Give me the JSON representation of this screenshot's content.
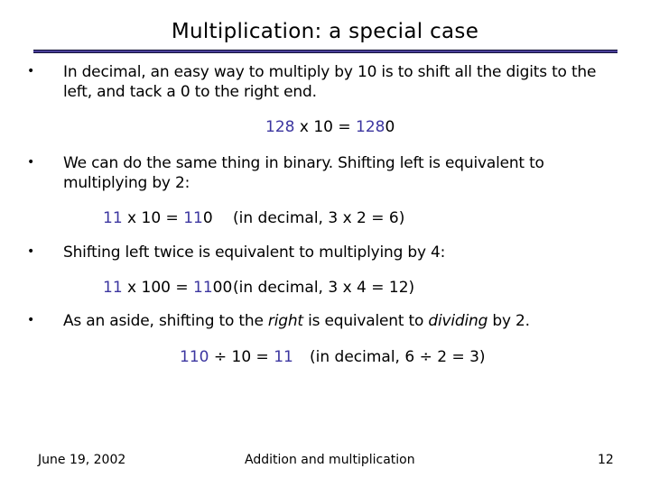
{
  "slide": {
    "title": "Multiplication: a special case",
    "accent_color": "#3c36a0",
    "rule_color": "#4a3f9a",
    "bullet_glyph": "•",
    "bullets": [
      {
        "line1": "In decimal, an easy way to multiply by 10 is to shift all the digits to the",
        "line2": "left, and tack a 0 to the right end."
      },
      {
        "line1": "We can do the same thing in binary. Shifting left is equivalent to",
        "line2": "multiplying by 2:"
      },
      {
        "line1": "Shifting left twice is equivalent to multiplying by 4:"
      },
      {
        "pre": "As an aside, shifting to the ",
        "em1": "right",
        "mid": " is equivalent to ",
        "em2": "dividing",
        "post": " by 2."
      }
    ],
    "equations": [
      {
        "a": "128",
        "op": " x 10 = ",
        "r_hl": "128",
        "r_plain": "0",
        "note": ""
      },
      {
        "a": "11",
        "op": " x 10 = ",
        "r_hl": "11",
        "r_plain": "0",
        "note": "(in decimal, 3 x 2 = 6)"
      },
      {
        "a": "11",
        "op": " x 100 = ",
        "r_hl": "11",
        "r_plain": "00",
        "note": "(in decimal, 3 x 4 = 12)"
      },
      {
        "a": "110",
        "op": " ÷ 10 = ",
        "r_hl": "11",
        "r_plain": "",
        "note": "(in decimal, 6 ÷ 2 = 3)"
      }
    ]
  },
  "footer": {
    "date": "June 19, 2002",
    "topic": "Addition and multiplication",
    "page_number": "12"
  }
}
